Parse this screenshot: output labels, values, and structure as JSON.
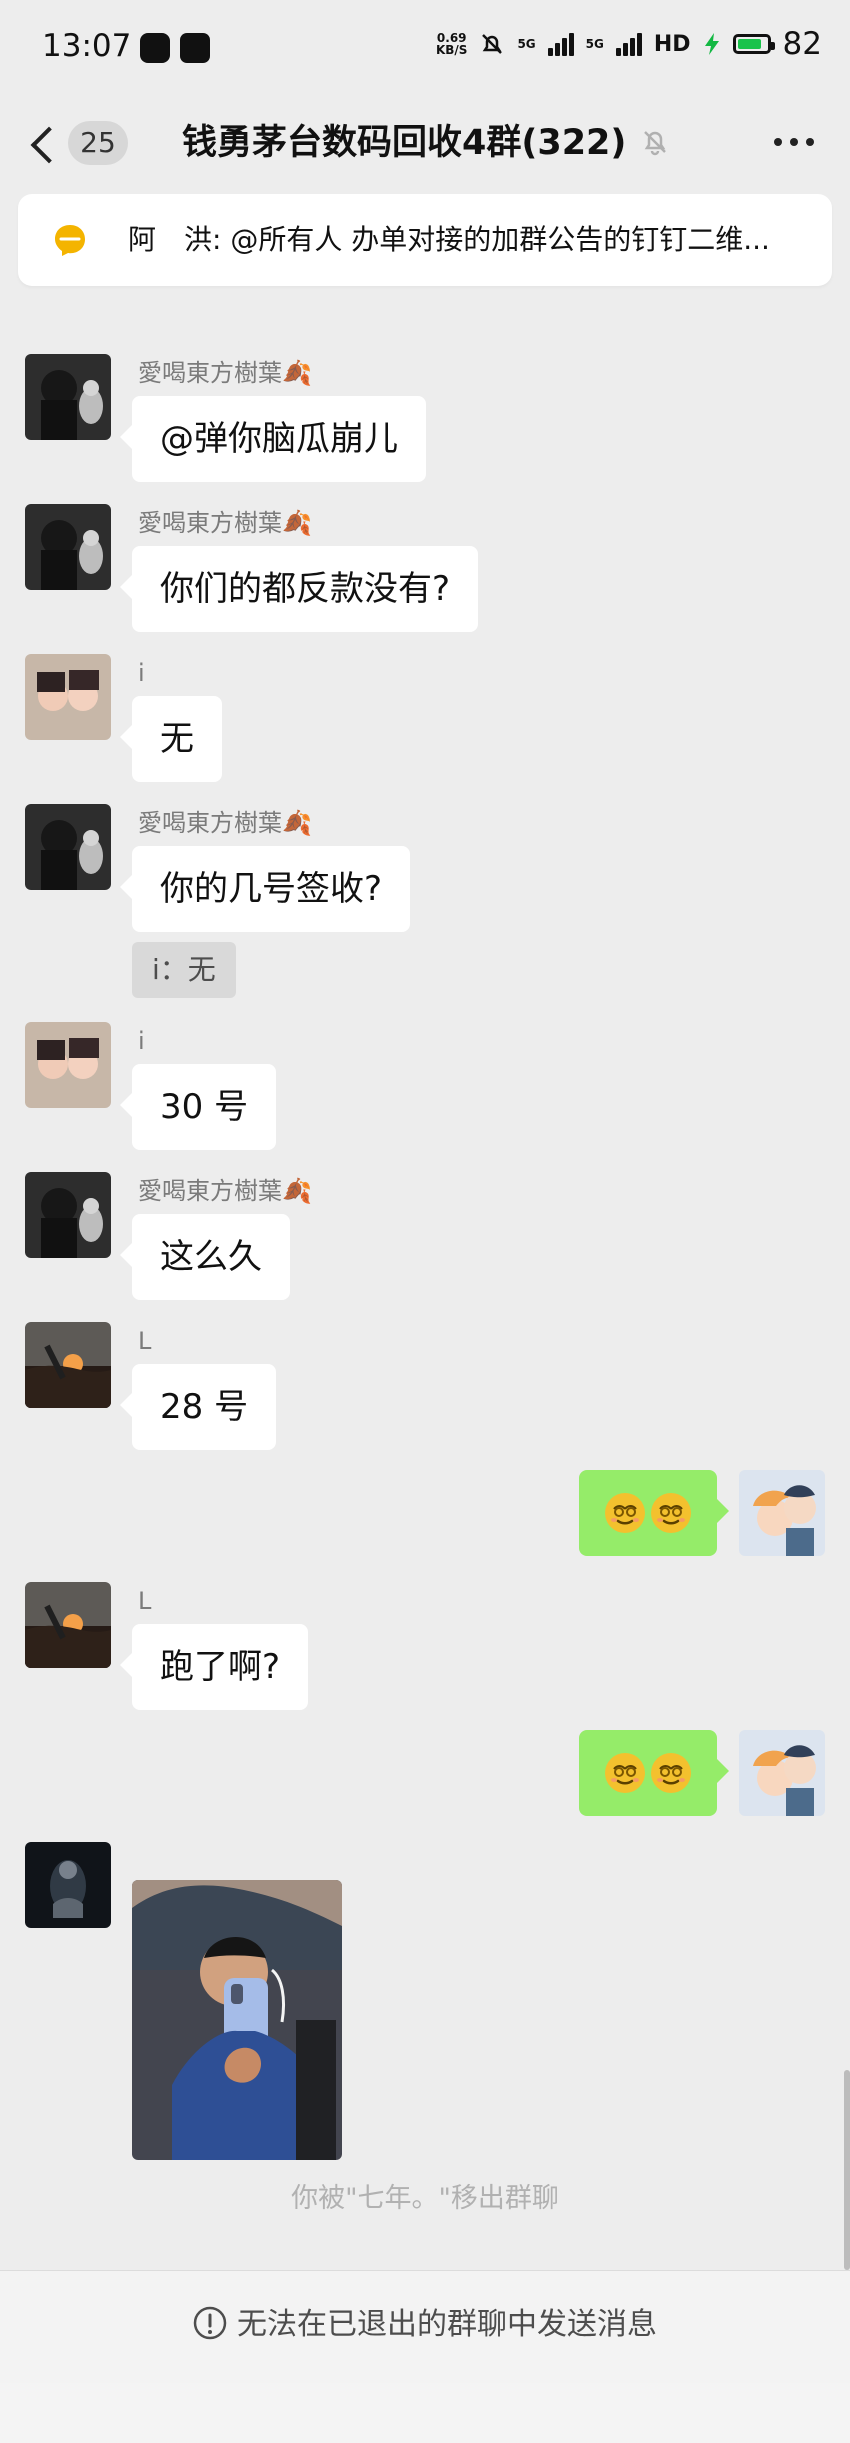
{
  "status_bar": {
    "time": "13:07",
    "network_speed_top": "0.69",
    "network_speed_bottom": "KB/S",
    "network_1": "5G",
    "network_2": "5G",
    "hd_label": "HD",
    "battery_level": "82",
    "battery_fraction": 0.82
  },
  "header": {
    "back_count": "25",
    "title": "钱勇茅台数码回收4群(322)"
  },
  "announcement": {
    "text": "阿　洪: @所有人 办单对接的加群公告的钉钉二维..."
  },
  "colors": {
    "background": "#ededed",
    "incoming_bubble": "#ffffff",
    "outgoing_bubble": "#95ec69",
    "muted_text": "#7b7b7b"
  },
  "messages": [
    {
      "sender": "愛喝東方樹葉🍂",
      "text": "@弹你脑瓜崩儿"
    },
    {
      "sender": "愛喝東方樹葉🍂",
      "text": "你们的都反款没有?"
    },
    {
      "sender": "i",
      "text": "无"
    },
    {
      "sender": "愛喝東方樹葉🍂",
      "text": "你的几号签收?",
      "quote": "i：无"
    },
    {
      "sender": "i",
      "text": "30 号"
    },
    {
      "sender": "愛喝東方樹葉🍂",
      "text": "这么久"
    },
    {
      "sender": "L",
      "text": "28 号"
    },
    {
      "sender": "L",
      "text": "跑了啊?"
    }
  ],
  "system_notice": "你被\"七年。\"移出群聊",
  "footer": {
    "text": "无法在已退出的群聊中发送消息"
  },
  "icons": {
    "back": "chevron-left-icon",
    "mute": "mute-bell-icon",
    "more": "more-dots-icon",
    "announcement": "announcement-bulb-icon",
    "footer": "info-circle-icon"
  }
}
